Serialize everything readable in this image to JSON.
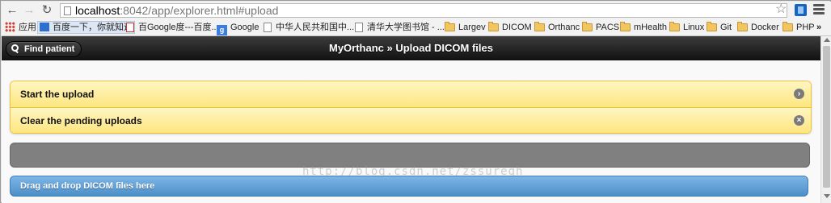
{
  "browser": {
    "url_host": "localhost",
    "url_rest": ":8042/app/explorer.html#upload",
    "bookmarks": [
      {
        "label": "应用",
        "icon": "apps-grid-icon"
      },
      {
        "label": "百度一下，你就知道",
        "icon": "baidu-icon"
      },
      {
        "label": "百Google度---百度...",
        "icon": "page-icon"
      },
      {
        "label": "Google",
        "icon": "google-icon"
      },
      {
        "label": "中华人民共和国中...",
        "icon": "page-icon"
      },
      {
        "label": "清华大学图书馆 - ...",
        "icon": "page-icon"
      },
      {
        "label": "Largev",
        "icon": "folder-icon"
      },
      {
        "label": "DICOM",
        "icon": "folder-icon"
      },
      {
        "label": "Orthanc",
        "icon": "folder-icon"
      },
      {
        "label": "PACS",
        "icon": "folder-icon"
      },
      {
        "label": "mHealth",
        "icon": "folder-icon"
      },
      {
        "label": "Linux",
        "icon": "folder-icon"
      },
      {
        "label": "Git",
        "icon": "folder-icon"
      },
      {
        "label": "Docker",
        "icon": "folder-icon"
      },
      {
        "label": "PHP",
        "icon": "folder-icon"
      }
    ],
    "overflow_label": "»"
  },
  "header": {
    "find_patient": "Find patient",
    "title": "MyOrthanc » Upload DICOM files"
  },
  "actions": {
    "start_upload": "Start the upload",
    "clear_uploads": "Clear the pending uploads"
  },
  "drop_zone": "Drag and drop DICOM files here",
  "watermark": "http://blog.csdn.net/zssureqh",
  "colors": {
    "header_bg": "#1a1a1a",
    "action_bg": "#fde680",
    "progress_bg": "#808080",
    "drop_bg": "#5b9bd5"
  }
}
